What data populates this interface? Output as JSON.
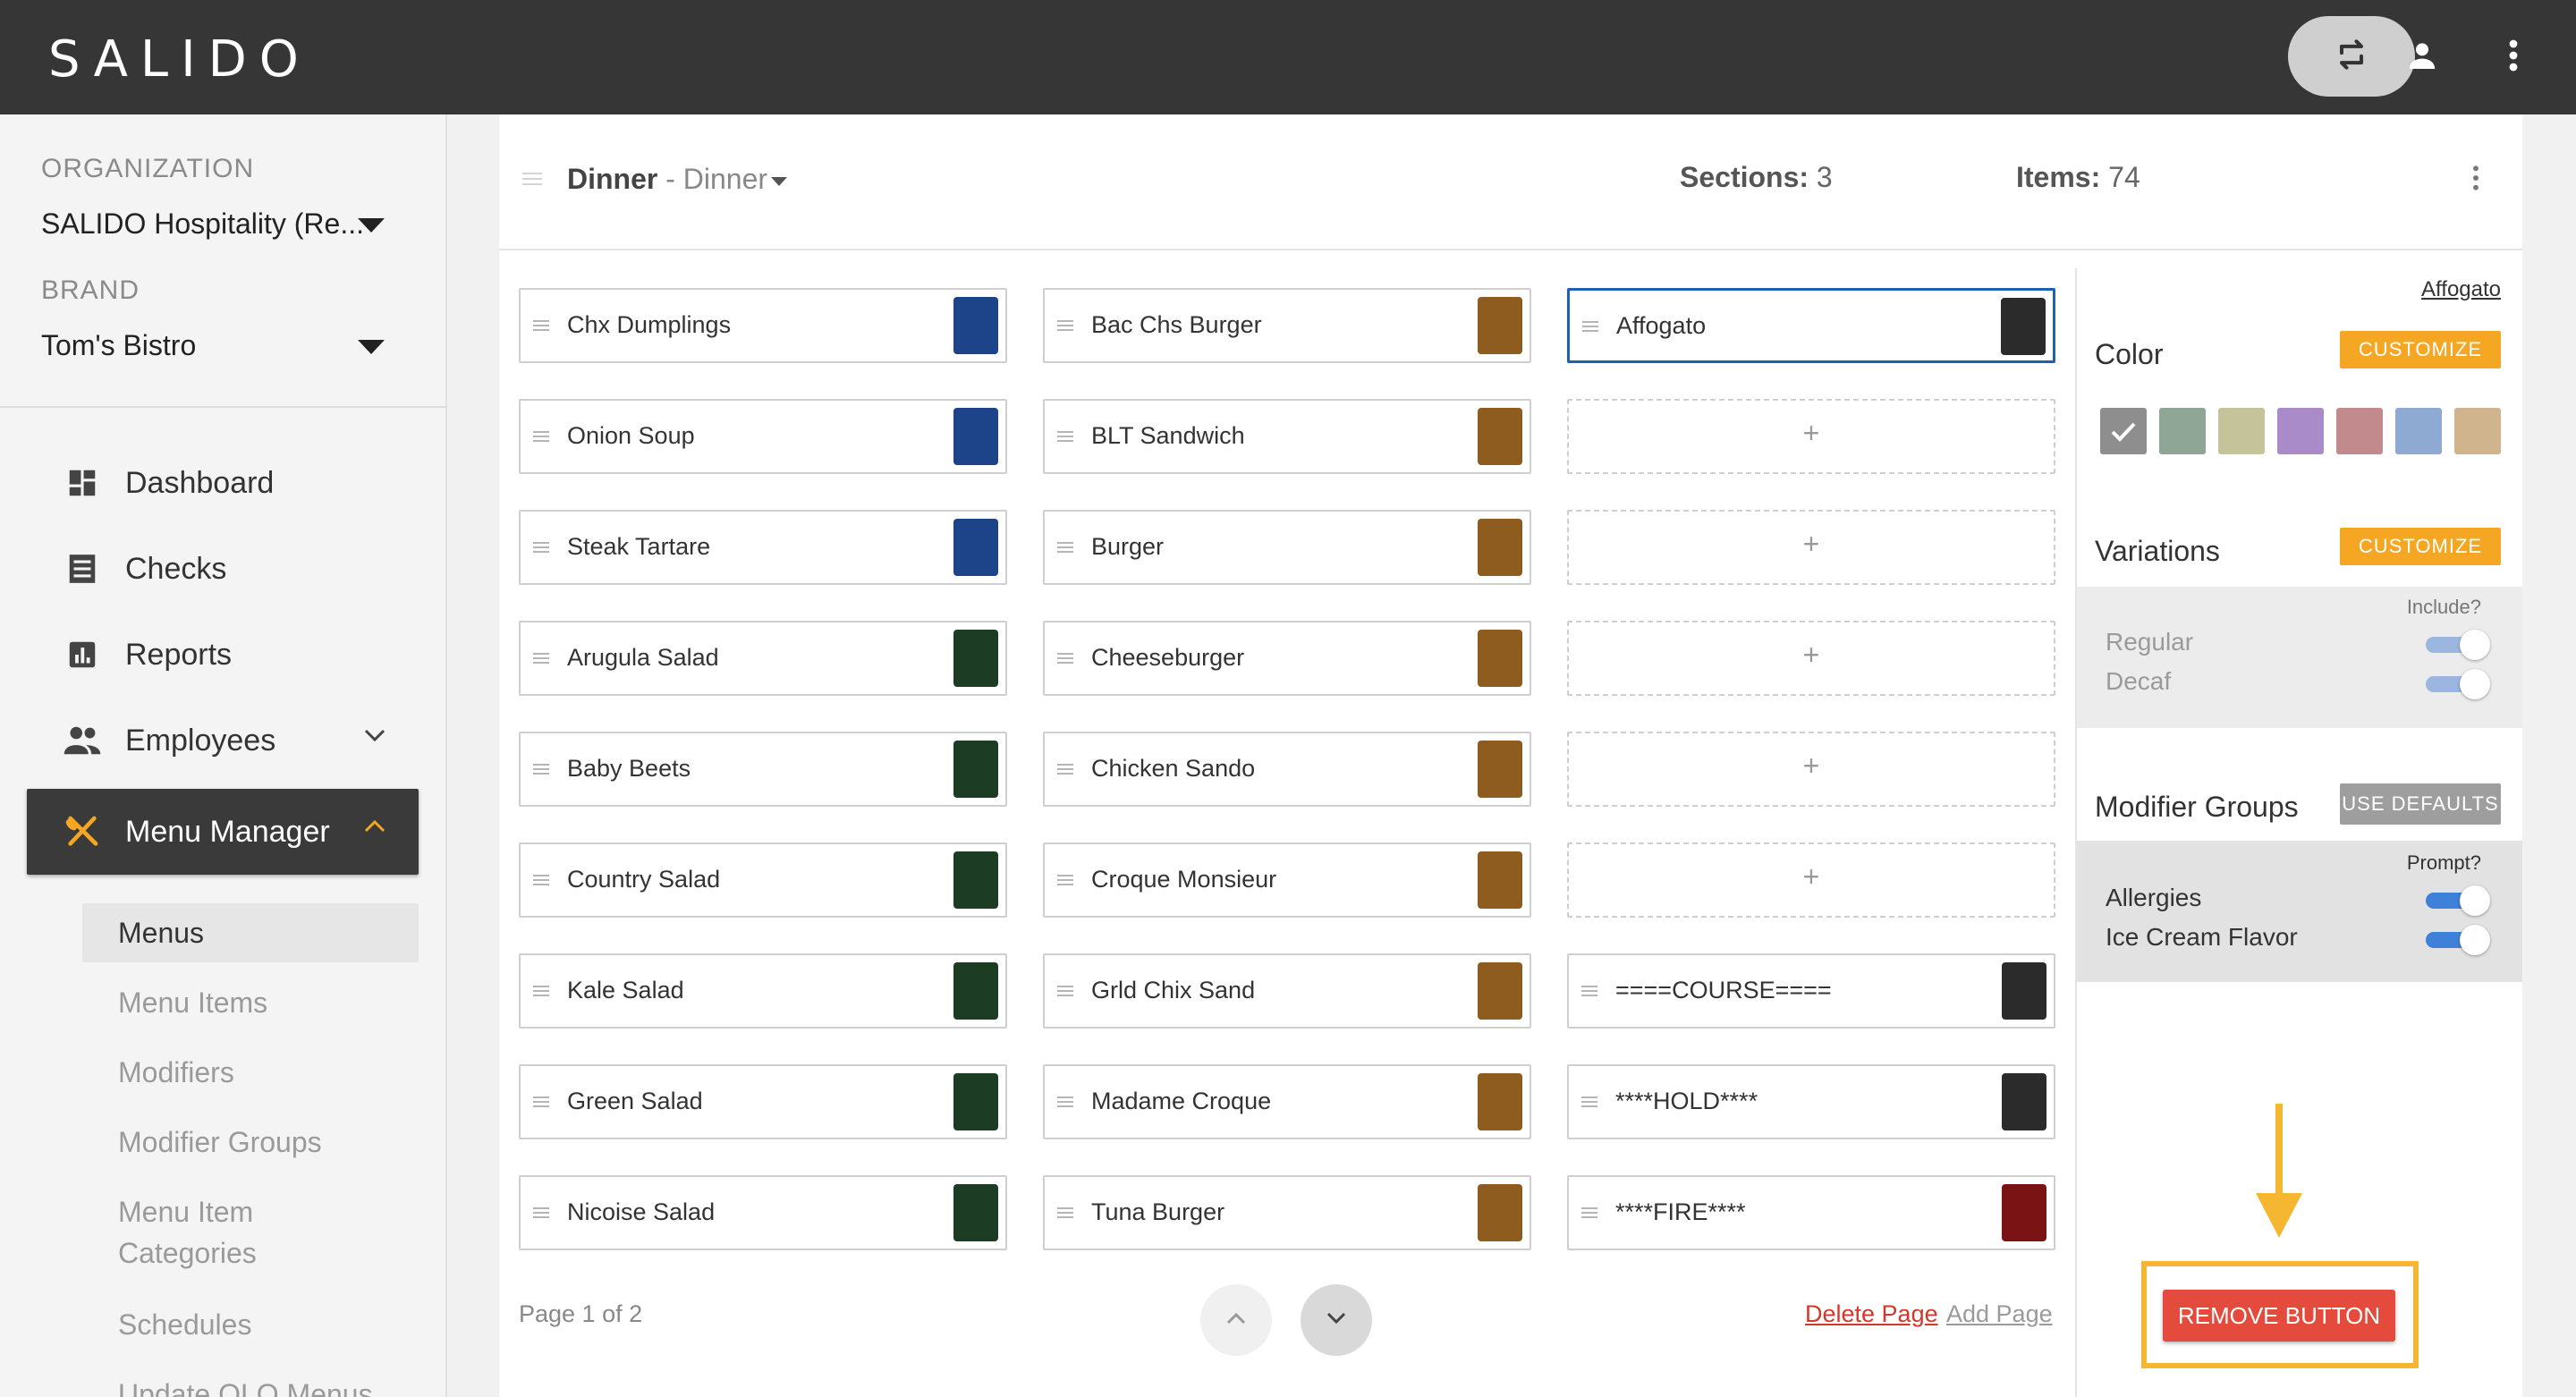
{
  "app": {
    "logo": "SALIDO"
  },
  "topbar": {
    "swap_icon": "swap-icon",
    "user_icon": "user-icon",
    "more_icon": "more-vert-icon"
  },
  "sidebar": {
    "org_label": "ORGANIZATION",
    "org_value": "SALIDO Hospitality (Re...",
    "brand_label": "BRAND",
    "brand_value": "Tom's Bistro",
    "nav": [
      {
        "label": "Dashboard",
        "icon": "dashboard-icon"
      },
      {
        "label": "Checks",
        "icon": "receipt-icon"
      },
      {
        "label": "Reports",
        "icon": "bar-chart-icon"
      },
      {
        "label": "Employees",
        "icon": "people-icon"
      },
      {
        "label": "Menu Manager",
        "icon": "fork-knife-icon"
      }
    ],
    "submenu": [
      "Menus",
      "Menu Items",
      "Modifiers",
      "Modifier Groups",
      "Menu Item",
      "Categories",
      "Schedules",
      "Update OLO Menus"
    ]
  },
  "menu_header": {
    "title": "Dinner",
    "separator": " - ",
    "subtitle": "Dinner",
    "sections_label": "Sections:",
    "sections_value": "3",
    "items_label": "Items:",
    "items_value": "74"
  },
  "colors": {
    "blue": "#1d4489",
    "green": "#1c3d24",
    "brown": "#8d5c1e",
    "dark": "#2b2b2b",
    "red": "#7a1414",
    "accent": "#f5a623",
    "remove": "#e44b3c"
  },
  "columns": [
    {
      "items": [
        {
          "name": "Chx Dumplings",
          "color": "#1d4489"
        },
        {
          "name": "Onion Soup",
          "color": "#1d4489"
        },
        {
          "name": "Steak Tartare",
          "color": "#1d4489"
        },
        {
          "name": "Arugula Salad",
          "color": "#1c3d24"
        },
        {
          "name": "Baby Beets",
          "color": "#1c3d24"
        },
        {
          "name": "Country Salad",
          "color": "#1c3d24"
        },
        {
          "name": "Kale Salad",
          "color": "#1c3d24"
        },
        {
          "name": "Green Salad",
          "color": "#1c3d24"
        },
        {
          "name": "Nicoise Salad",
          "color": "#1c3d24"
        }
      ]
    },
    {
      "items": [
        {
          "name": "Bac Chs Burger",
          "color": "#8d5c1e"
        },
        {
          "name": "BLT Sandwich",
          "color": "#8d5c1e"
        },
        {
          "name": "Burger",
          "color": "#8d5c1e"
        },
        {
          "name": "Cheeseburger",
          "color": "#8d5c1e"
        },
        {
          "name": "Chicken Sando",
          "color": "#8d5c1e"
        },
        {
          "name": "Croque Monsieur",
          "color": "#8d5c1e"
        },
        {
          "name": "Grld Chix Sand",
          "color": "#8d5c1e"
        },
        {
          "name": "Madame Croque",
          "color": "#8d5c1e"
        },
        {
          "name": "Tuna Burger",
          "color": "#8d5c1e"
        }
      ]
    },
    {
      "items": [
        {
          "name": "Affogato",
          "color": "#2b2b2b",
          "selected": true
        },
        {
          "name": "",
          "empty": true,
          "plus": "+"
        },
        {
          "name": "",
          "empty": true,
          "plus": "+"
        },
        {
          "name": "",
          "empty": true,
          "plus": "+"
        },
        {
          "name": "",
          "empty": true,
          "plus": "+"
        },
        {
          "name": "",
          "empty": true,
          "plus": "+"
        },
        {
          "name": "====COURSE====",
          "color": "#2b2b2b"
        },
        {
          "name": "****HOLD****",
          "color": "#2b2b2b"
        },
        {
          "name": "****FIRE****",
          "color": "#7a1414"
        }
      ]
    }
  ],
  "footer": {
    "page_info": "Page 1 of 2",
    "delete_page": "Delete Page",
    "add_page": "Add Page"
  },
  "right_panel": {
    "selected_item": "Affogato",
    "color_label": "Color",
    "customize_label": "CUSTOMIZE",
    "swatches": [
      "#8e8e8e",
      "#8fa595",
      "#c4c39a",
      "#a98bc9",
      "#c28a8c",
      "#8eaad2",
      "#cfb48e"
    ],
    "variations_label": "Variations",
    "include_label": "Include?",
    "variations": [
      {
        "name": "Regular",
        "on": true
      },
      {
        "name": "Decaf",
        "on": true
      }
    ],
    "modifier_groups_label": "Modifier Groups",
    "use_defaults_label": "USE DEFAULTS",
    "prompt_label": "Prompt?",
    "modifier_groups": [
      {
        "name": "Allergies",
        "on": true
      },
      {
        "name": "Ice Cream Flavor",
        "on": true
      }
    ],
    "remove_button_label": "REMOVE BUTTON"
  }
}
